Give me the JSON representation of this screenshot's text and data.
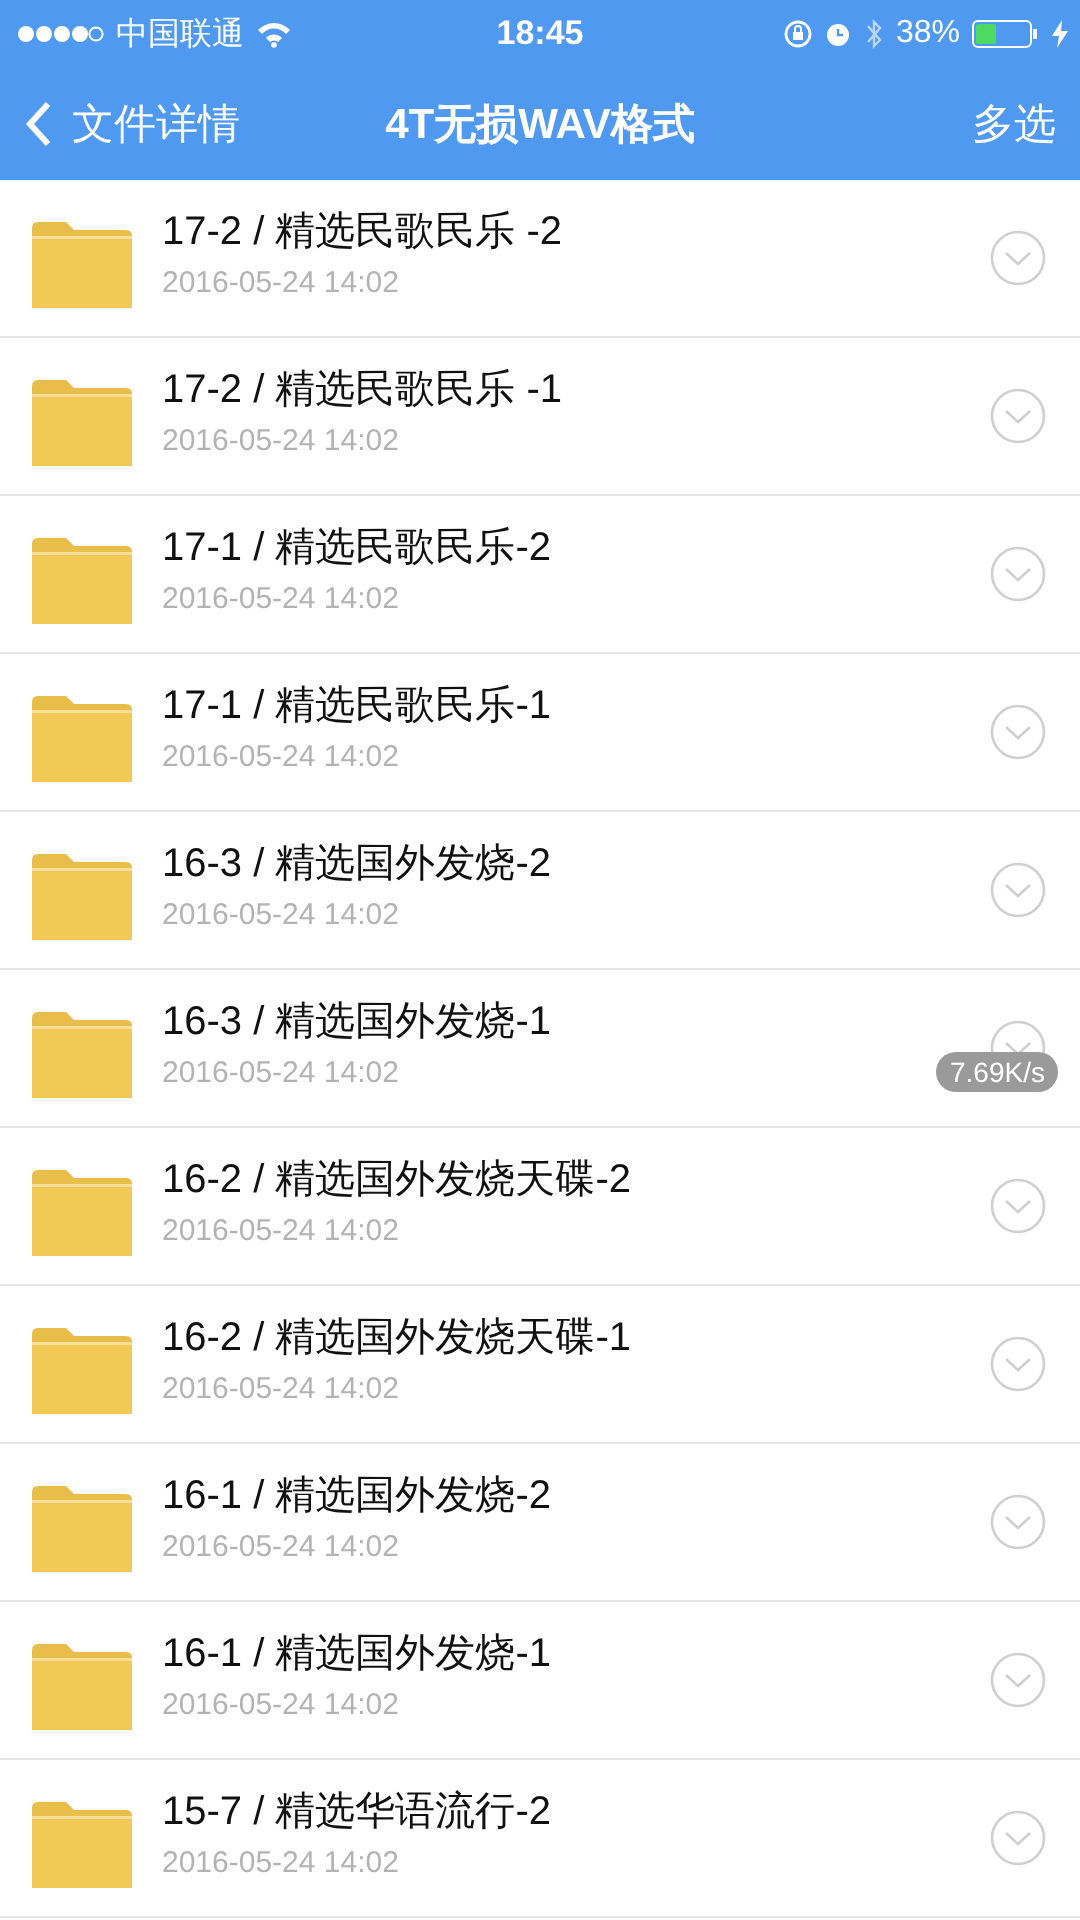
{
  "status_bar": {
    "carrier": "中国联通",
    "time": "18:45",
    "battery": "38%"
  },
  "nav_bar": {
    "back": "文件详情",
    "title": "4T无损WAV格式",
    "action": "多选"
  },
  "files": [
    {
      "name": "17-2 / 精选民歌民乐 -2",
      "date": "2016-05-24 14:02"
    },
    {
      "name": "17-2 / 精选民歌民乐 -1",
      "date": "2016-05-24 14:02"
    },
    {
      "name": "17-1 / 精选民歌民乐-2",
      "date": "2016-05-24 14:02"
    },
    {
      "name": "17-1 / 精选民歌民乐-1",
      "date": "2016-05-24 14:02"
    },
    {
      "name": "16-3 / 精选国外发烧-2",
      "date": "2016-05-24 14:02"
    },
    {
      "name": "16-3 / 精选国外发烧-1",
      "date": "2016-05-24 14:02"
    },
    {
      "name": "16-2 / 精选国外发烧天碟-2",
      "date": "2016-05-24 14:02"
    },
    {
      "name": "16-2 / 精选国外发烧天碟-1",
      "date": "2016-05-24 14:02"
    },
    {
      "name": "16-1 / 精选国外发烧-2",
      "date": "2016-05-24 14:02"
    },
    {
      "name": "16-1 / 精选国外发烧-1",
      "date": "2016-05-24 14:02"
    },
    {
      "name": "15-7 / 精选华语流行-2",
      "date": "2016-05-24 14:02"
    }
  ],
  "speed_badge": "7.69K/s"
}
